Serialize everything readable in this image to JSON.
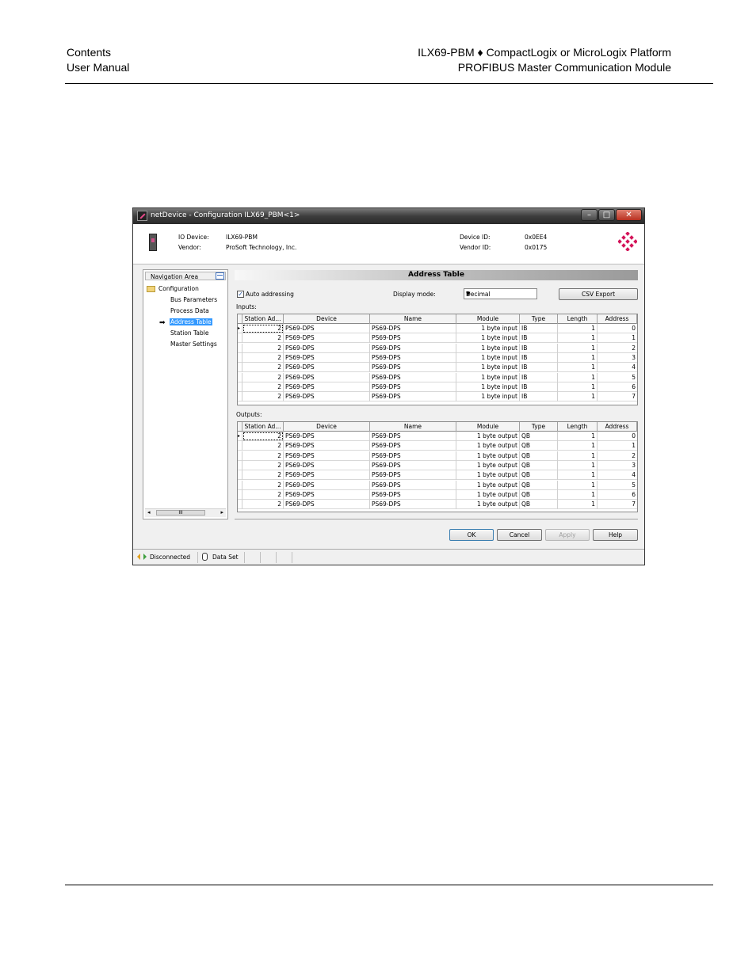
{
  "header": {
    "left_line1": "Contents",
    "left_line2": "User Manual",
    "right_line1": "ILX69-PBM ♦ CompactLogix or MicroLogix Platform",
    "right_line2": "PROFIBUS Master Communication Module"
  },
  "window": {
    "title": "netDevice - Configuration ILX69_PBM<1>",
    "controls": {
      "minimize": "–",
      "maximize": "□",
      "close": "✕"
    },
    "device": {
      "io_device_label": "IO Device:",
      "io_device_value": "ILX69-PBM",
      "vendor_label": "Vendor:",
      "vendor_value": "ProSoft Technology, Inc.",
      "device_id_label": "Device ID:",
      "device_id_value": "0x0EE4",
      "vendor_id_label": "Vendor ID:",
      "vendor_id_value": "0x0175"
    },
    "navigation": {
      "title": "Navigation Area",
      "root": "Configuration",
      "items": [
        "Bus Parameters",
        "Process Data",
        "Address Table",
        "Station Table",
        "Master Settings"
      ],
      "selected": "Address Table",
      "scroll_thumb": "III"
    },
    "panel_title": "Address Table",
    "auto_addressing_label": "Auto addressing",
    "display_mode_label": "Display mode:",
    "display_mode_value": "Decimal",
    "csv_export_label": "CSV Export",
    "inputs_label": "Inputs:",
    "outputs_label": "Outputs:",
    "columns": [
      "Station Ad...",
      "Device",
      "Name",
      "Module",
      "Type",
      "Length",
      "Address"
    ],
    "inputs": [
      [
        "2",
        "PS69-DPS",
        "PS69-DPS",
        "1 byte input",
        "IB",
        "1",
        "0"
      ],
      [
        "2",
        "PS69-DPS",
        "PS69-DPS",
        "1 byte input",
        "IB",
        "1",
        "1"
      ],
      [
        "2",
        "PS69-DPS",
        "PS69-DPS",
        "1 byte input",
        "IB",
        "1",
        "2"
      ],
      [
        "2",
        "PS69-DPS",
        "PS69-DPS",
        "1 byte input",
        "IB",
        "1",
        "3"
      ],
      [
        "2",
        "PS69-DPS",
        "PS69-DPS",
        "1 byte input",
        "IB",
        "1",
        "4"
      ],
      [
        "2",
        "PS69-DPS",
        "PS69-DPS",
        "1 byte input",
        "IB",
        "1",
        "5"
      ],
      [
        "2",
        "PS69-DPS",
        "PS69-DPS",
        "1 byte input",
        "IB",
        "1",
        "6"
      ],
      [
        "2",
        "PS69-DPS",
        "PS69-DPS",
        "1 byte input",
        "IB",
        "1",
        "7"
      ]
    ],
    "outputs": [
      [
        "2",
        "PS69-DPS",
        "PS69-DPS",
        "1 byte output",
        "QB",
        "1",
        "0"
      ],
      [
        "2",
        "PS69-DPS",
        "PS69-DPS",
        "1 byte output",
        "QB",
        "1",
        "1"
      ],
      [
        "2",
        "PS69-DPS",
        "PS69-DPS",
        "1 byte output",
        "QB",
        "1",
        "2"
      ],
      [
        "2",
        "PS69-DPS",
        "PS69-DPS",
        "1 byte output",
        "QB",
        "1",
        "3"
      ],
      [
        "2",
        "PS69-DPS",
        "PS69-DPS",
        "1 byte output",
        "QB",
        "1",
        "4"
      ],
      [
        "2",
        "PS69-DPS",
        "PS69-DPS",
        "1 byte output",
        "QB",
        "1",
        "5"
      ],
      [
        "2",
        "PS69-DPS",
        "PS69-DPS",
        "1 byte output",
        "QB",
        "1",
        "6"
      ],
      [
        "2",
        "PS69-DPS",
        "PS69-DPS",
        "1 byte output",
        "QB",
        "1",
        "7"
      ]
    ],
    "buttons": {
      "ok": "OK",
      "cancel": "Cancel",
      "apply": "Apply",
      "help": "Help"
    },
    "status": {
      "connection": "Disconnected",
      "dataset": "Data Set"
    },
    "colors": {
      "selection": "#3399ff",
      "logo": "#d4145a"
    }
  }
}
